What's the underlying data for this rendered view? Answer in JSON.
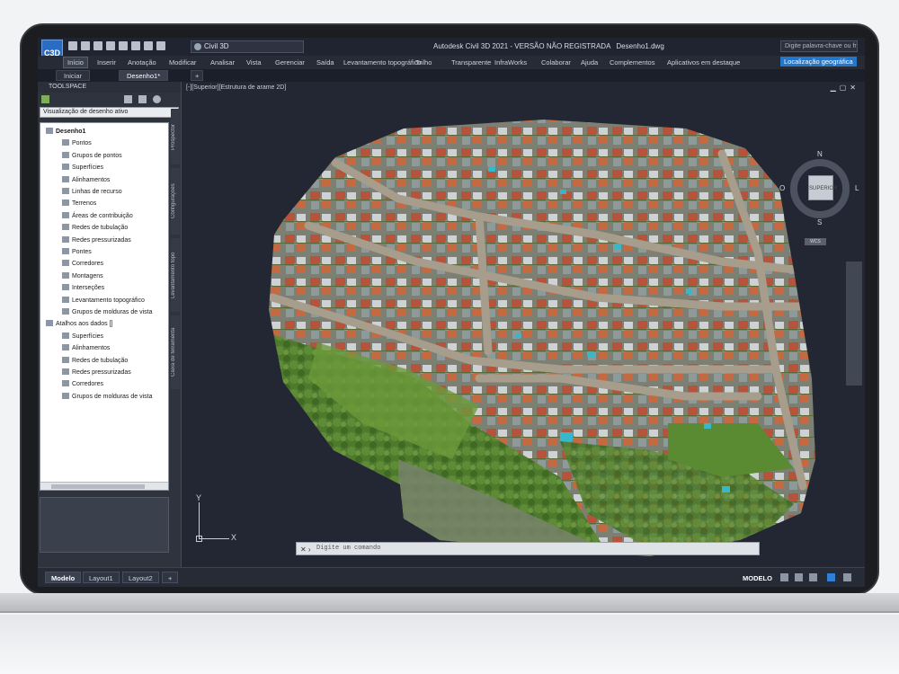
{
  "titlebar": {
    "app_icon_label": "C3D",
    "workspace": "Civil 3D",
    "title": "Autodesk Civil 3D 2021 - VERSÃO NÃO REGISTRADA",
    "filename": "Desenho1.dwg",
    "search_placeholder": "Digite palavra-chave ou frase"
  },
  "ribbon": {
    "tabs": [
      "Início",
      "Inserir",
      "Anotação",
      "Modificar",
      "Analisar",
      "Vista",
      "Gerenciar",
      "Saída",
      "Levantamento topográfico",
      "Trilho",
      "Transparente",
      "InfraWorks",
      "Colaborar",
      "Ajuda",
      "Complementos",
      "Aplicativos em destaque",
      "Localização geográfica"
    ]
  },
  "doctabs": {
    "tabs": [
      "Iniciar",
      "Desenho1*"
    ],
    "add": "+"
  },
  "toolspace": {
    "title": "TOOLSPACE",
    "view": "Visualização de desenho ativo",
    "tree": [
      {
        "label": "Desenho1",
        "level": 0,
        "bold": true
      },
      {
        "label": "Pontos",
        "level": 2
      },
      {
        "label": "Grupos de pontos",
        "level": 2
      },
      {
        "label": "Superfícies",
        "level": 2
      },
      {
        "label": "Alinhamentos",
        "level": 2
      },
      {
        "label": "Linhas de recurso",
        "level": 2
      },
      {
        "label": "Terrenos",
        "level": 2
      },
      {
        "label": "Áreas de contribuição",
        "level": 2
      },
      {
        "label": "Redes de tubulação",
        "level": 2
      },
      {
        "label": "Redes pressurizadas",
        "level": 2
      },
      {
        "label": "Pontes",
        "level": 2
      },
      {
        "label": "Corredores",
        "level": 2
      },
      {
        "label": "Montagens",
        "level": 2
      },
      {
        "label": "Interseções",
        "level": 2
      },
      {
        "label": "Levantamento topográfico",
        "level": 2
      },
      {
        "label": "Grupos de molduras de vista",
        "level": 2
      },
      {
        "label": "Atalhos aos dados []",
        "level": 0
      },
      {
        "label": "Superfícies",
        "level": 2
      },
      {
        "label": "Alinhamentos",
        "level": 2
      },
      {
        "label": "Redes de tubulação",
        "level": 2
      },
      {
        "label": "Redes pressurizadas",
        "level": 2
      },
      {
        "label": "Corredores",
        "level": 2
      },
      {
        "label": "Grupos de molduras de vista",
        "level": 2
      }
    ],
    "side_tabs": [
      "Prospector",
      "Configurações",
      "Levantamento topo",
      "Caixa de ferramenta"
    ]
  },
  "viewport": {
    "label": "[-][Superior][Estrutura de arame 2D]",
    "compass": {
      "n": "N",
      "s": "S",
      "e": "L",
      "w": "O",
      "cube": "SUPERIOR",
      "wcs": "WCS"
    },
    "ucs": {
      "x": "X",
      "y": "Y"
    },
    "command_placeholder": "Digite um comando"
  },
  "statusbar": {
    "tabs": [
      "Modelo",
      "Layout1",
      "Layout2"
    ],
    "add": "+",
    "mode": "MODELO"
  },
  "colors": {
    "ribbon_active": "#2476c9",
    "background": "#222733"
  }
}
